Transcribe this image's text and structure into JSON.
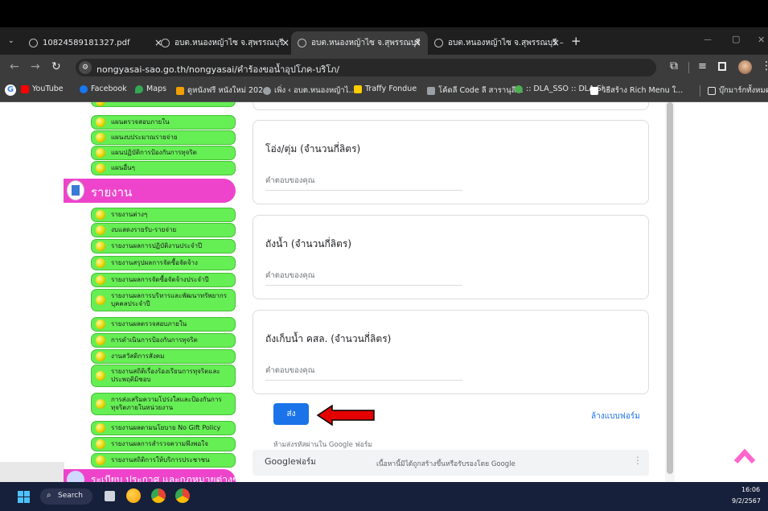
{
  "browser": {
    "tabs": [
      {
        "label": "10824589181327.pdf",
        "close": "×"
      },
      {
        "label": "อบต.หนองหญ้าไซ จ.สุพรรณบุรี",
        "close": "×"
      },
      {
        "label": "อบต.หนองหญ้าไซ จ.สุพรรณบุรี",
        "close": "×"
      },
      {
        "label": "อบต.หนองหญ้าไซ จ.สุพรรณบุรี – อ",
        "close": "×"
      }
    ],
    "new_tab": "+",
    "window_controls": {
      "minimize": "—",
      "restore": "▢",
      "close": "✕"
    },
    "url": "nongyasai-sao.go.th/nongyasai/คำร้องขอน้ำอุปโภค-บริโภ/",
    "bookmarks": [
      {
        "label": "YouTube",
        "color": "#ff0000"
      },
      {
        "label": "Facebook",
        "color": "#1877f2"
      },
      {
        "label": "Maps",
        "color": "#34a853"
      },
      {
        "label": "ดูหนังฟรี หนังใหม่ 202...",
        "color": "#f0a000"
      },
      {
        "label": "เพิ่ง ‹ อบต.หนองหญ้าไ...",
        "color": "#9aa0a6"
      },
      {
        "label": "Traffy Fondue",
        "color": "#ffcc00"
      },
      {
        "label": "โค้ดลี Code ลี สารานุลี...",
        "color": "#9aa0a6"
      },
      {
        "label": ":: DLA_SSO :: DLA Si...",
        "color": "#4caf50"
      },
      {
        "label": "วิธีสร้าง Rich Menu ใ...",
        "color": "#ffffff"
      }
    ],
    "bookmarks_folder": "บุ๊กมาร์กทั้งหมด"
  },
  "sidebar": {
    "top_items": [
      "แผนตรวจสอบภายใน",
      "แผนงบประมาณรายจ่าย",
      "แผนปฏิบัติการป้องกันการทุจริต",
      "แผนอื่นๆ"
    ],
    "report_header": "รายงาน",
    "report_items": [
      "รายงานต่างๆ",
      "งบแสดงรายรับ-รายจ่าย",
      "รายงานผลการปฏิบัติงานประจำปี",
      "รายงานสรุปผลการจัดซื้อจัดจ้าง",
      "รายงานผลการจัดซื้อจัดจ้างประจำปี",
      "รายงานผลการบริหารและพัฒนาทรัพยากรบุคคลประจำปี",
      "รายงานผลตรวจสอบภายใน",
      "การดำเนินการป้องกันการทุจริต",
      "งานสวัสดิการสังคม",
      "รายงานสถิติเรื่องร้องเรียนการทุจริตและประพฤติมิชอบ",
      "การส่งเสริมความโปร่งใสและป้องกันการทุจริตภายในหน่วยงาน",
      "รายงานผลตามนโยบาย No Gift Policy",
      "รายงานผลการสำรวจความพึงพอใจ",
      "รายงานสถิติการให้บริการประชาชน"
    ],
    "bottom_header": "ระเบียบ ประกาศ และกฎหมายต่างๆ"
  },
  "form": {
    "questions": [
      {
        "label": "โอ่ง/ตุ่ม (จำนวนกี่ลิตร)",
        "placeholder": "คำตอบของคุณ"
      },
      {
        "label": "ถังน้ำ  (จำนวนกี่ลิตร)",
        "placeholder": "คำตอบของคุณ"
      },
      {
        "label": "ถังเก็บน้ำ คสล.  (จำนวนกี่ลิตร)",
        "placeholder": "คำตอบของคุณ"
      }
    ],
    "submit_label": "ส่ง",
    "clear_label": "ล้างแบบฟอร์ม",
    "password_warning": "ห้ามส่งรหัสผ่านใน Google ฟอร์ม",
    "footer_brand_google": "Google",
    "footer_brand_forms": "ฟอร์ม",
    "footer_disclaimer": "เนื้อหานี้มิได้ถูกสร้างขึ้นหรือรับรองโดย Google"
  },
  "taskbar": {
    "search_label": "Search",
    "time": "16:06",
    "date": "9/2/2567"
  },
  "colors": {
    "sidebar_green": "#66ee55",
    "header_pink": "#ee44cc",
    "submit_blue": "#1a73e8",
    "arrow_red": "#e50000",
    "scroll_up_pink": "#ff66cc"
  }
}
